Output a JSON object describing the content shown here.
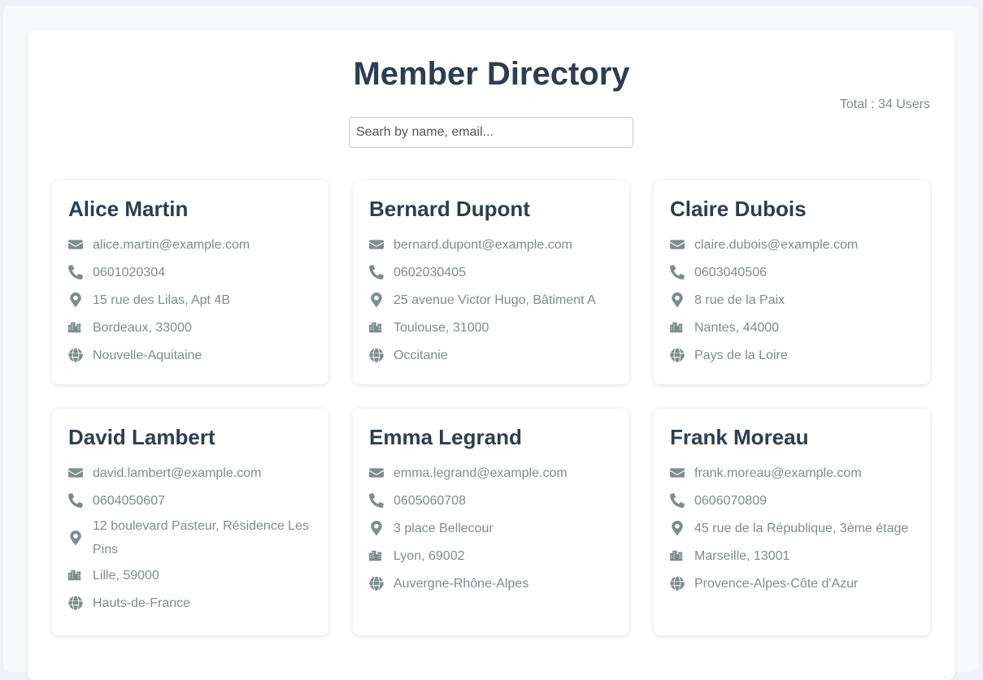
{
  "header": {
    "title": "Member Directory",
    "total": "Total : 34 Users"
  },
  "search": {
    "placeholder": "Searh by name, email...",
    "value": ""
  },
  "colors": {
    "heading": "#2c3e50",
    "muted": "#7f8c8d",
    "background": "#eef2f7"
  },
  "icons": {
    "email": "envelope-icon",
    "phone": "phone-icon",
    "address": "map-marker-icon",
    "city": "city-icon",
    "region": "globe-icon"
  },
  "members": [
    {
      "name": "Alice Martin",
      "email": "alice.martin@example.com",
      "phone": "0601020304",
      "address": "15 rue des Lilas, Apt 4B",
      "city": "Bordeaux, 33000",
      "region": "Nouvelle-Aquitaine"
    },
    {
      "name": "Bernard Dupont",
      "email": "bernard.dupont@example.com",
      "phone": "0602030405",
      "address": "25 avenue Victor Hugo, Bâtiment A",
      "city": "Toulouse, 31000",
      "region": "Occitanie"
    },
    {
      "name": "Claire Dubois",
      "email": "claire.dubois@example.com",
      "phone": "0603040506",
      "address": "8 rue de la Paix",
      "city": "Nantes, 44000",
      "region": "Pays de la Loire"
    },
    {
      "name": "David Lambert",
      "email": "david.lambert@example.com",
      "phone": "0604050607",
      "address": "12 boulevard Pasteur, Résidence Les Pins",
      "city": "Lille, 59000",
      "region": "Hauts-de-France"
    },
    {
      "name": "Emma Legrand",
      "email": "emma.legrand@example.com",
      "phone": "0605060708",
      "address": "3 place Bellecour",
      "city": "Lyon, 69002",
      "region": "Auvergne-Rhône-Alpes"
    },
    {
      "name": "Frank Moreau",
      "email": "frank.moreau@example.com",
      "phone": "0606070809",
      "address": "45 rue de la République, 3ème étage",
      "city": "Marseille, 13001",
      "region": "Provence-Alpes-Côte d'Azur"
    }
  ]
}
